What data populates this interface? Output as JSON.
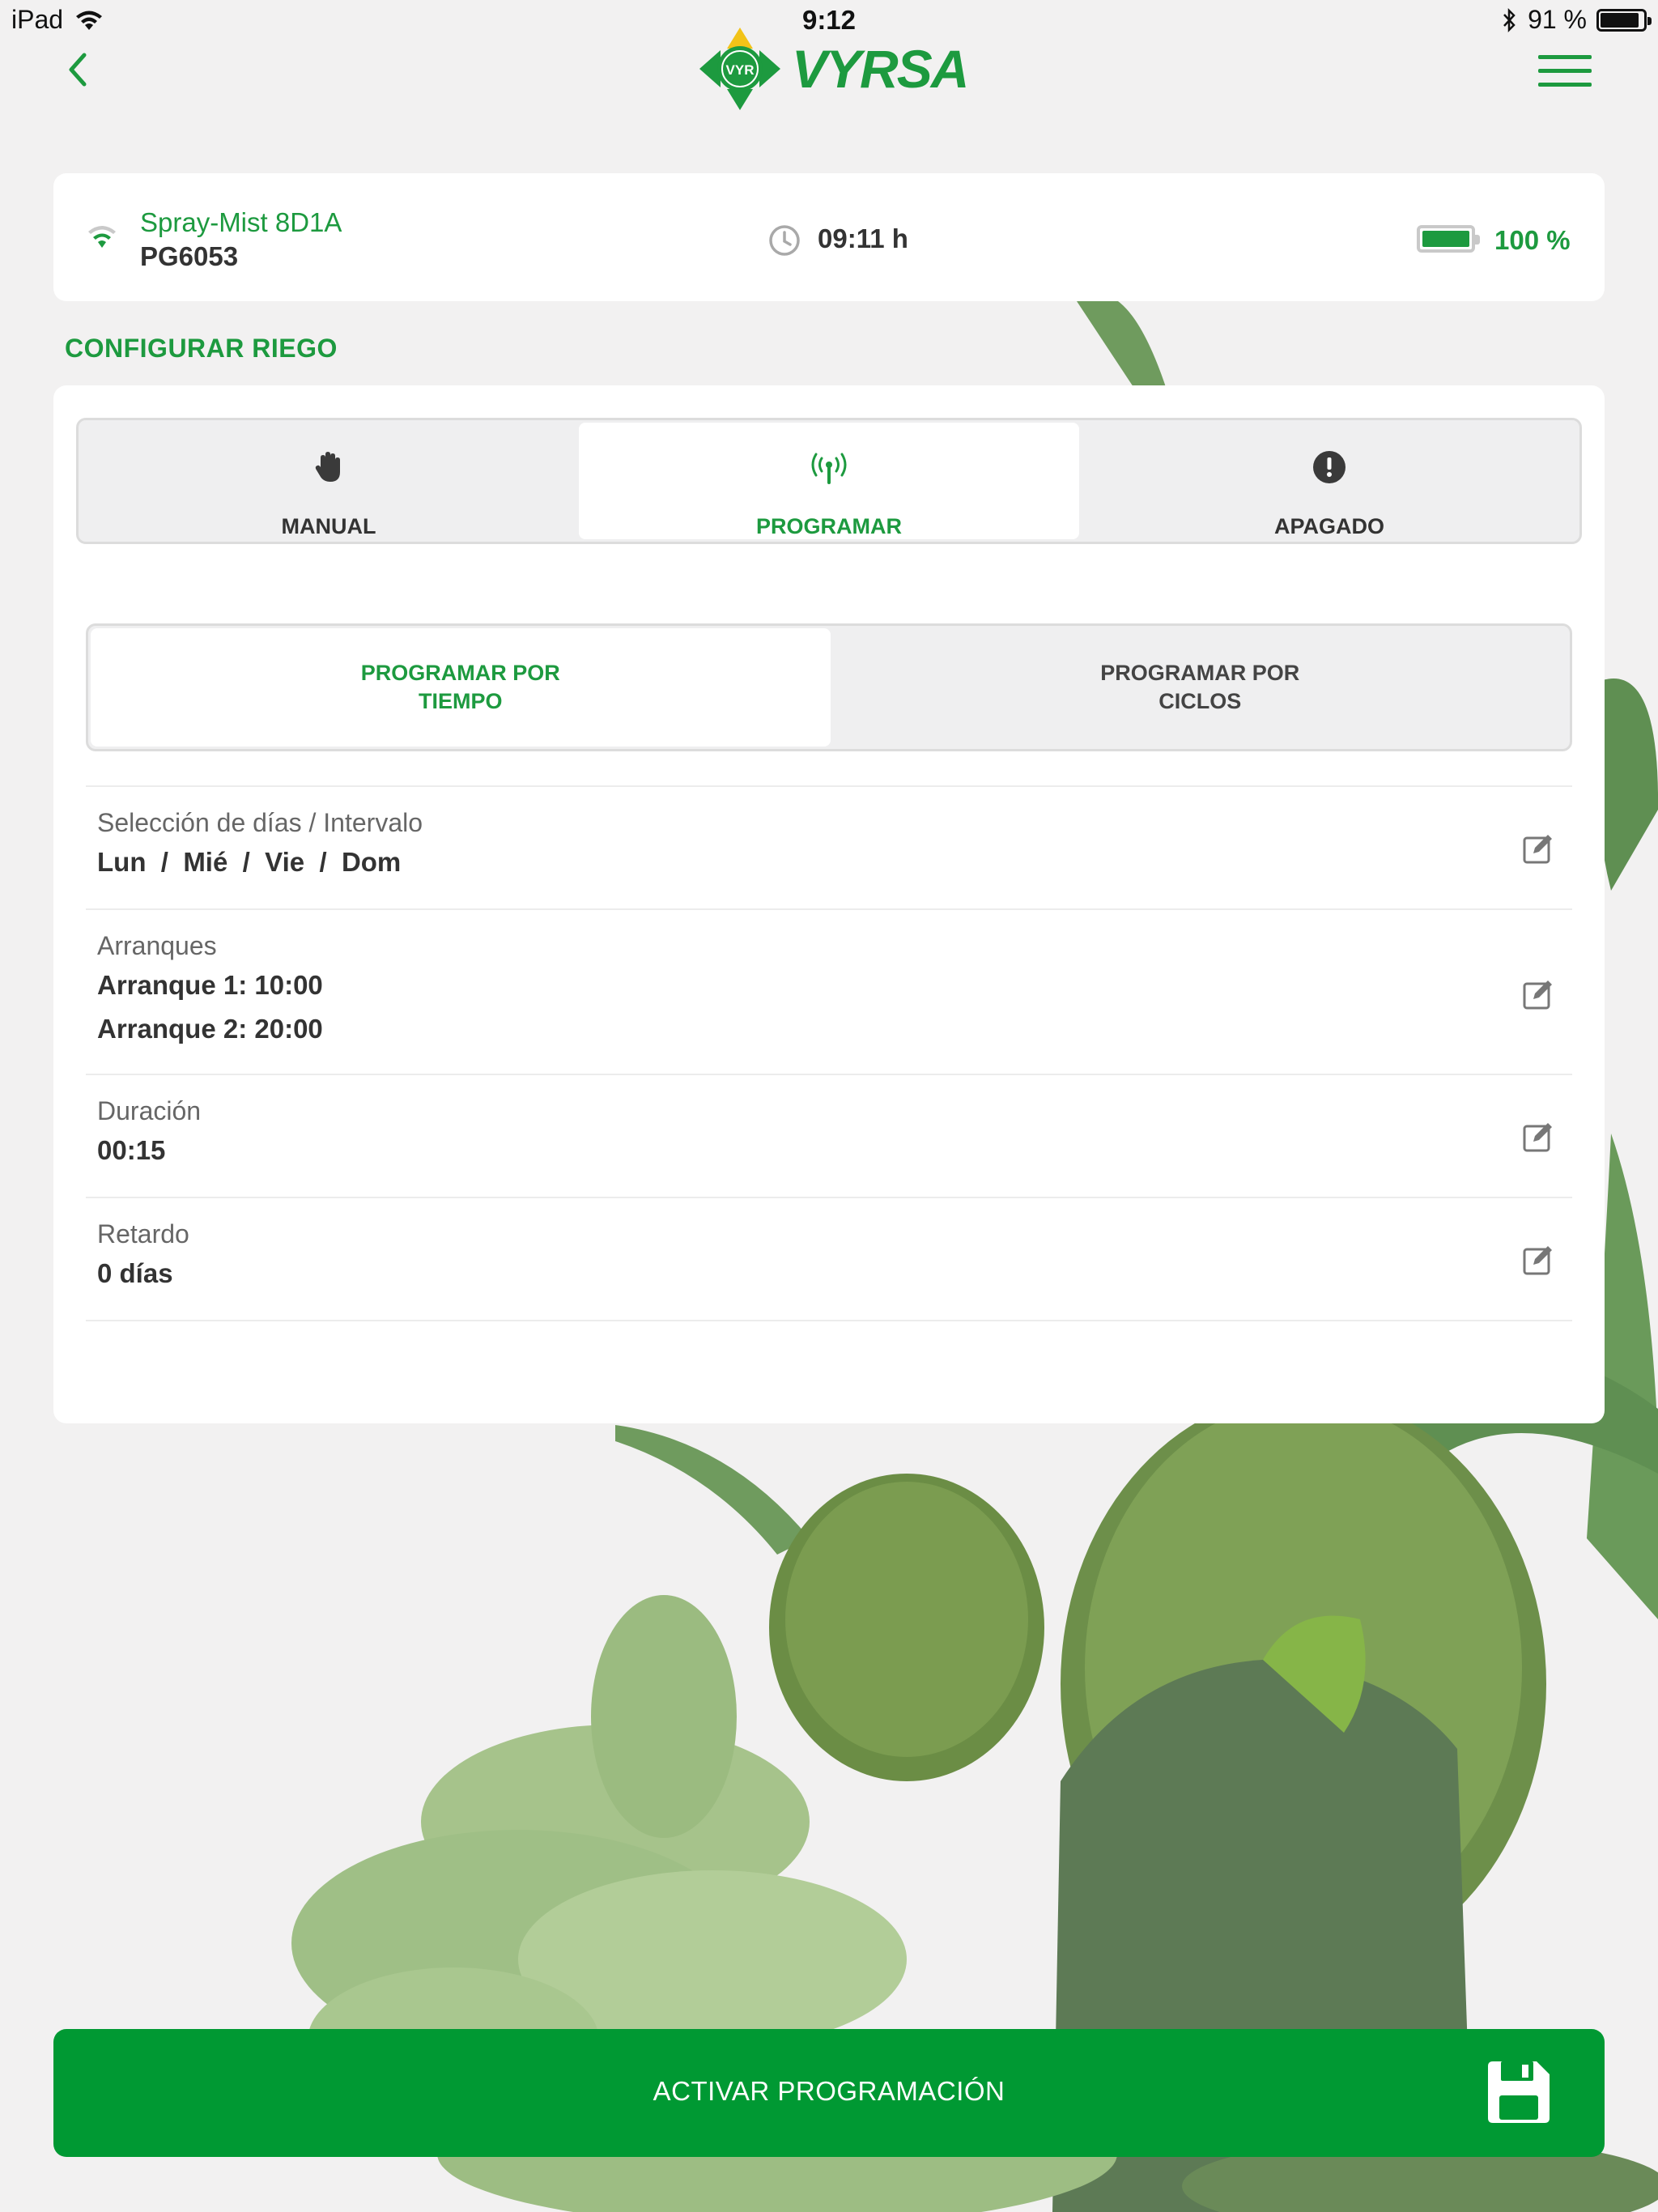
{
  "status_bar": {
    "device": "iPad",
    "time": "9:12",
    "battery": "91 %",
    "battery_level": 0.91
  },
  "nav": {
    "logo_text": "VYRSA",
    "logo_badge": "VYR"
  },
  "device": {
    "name": "Spray-Mist 8D1A",
    "model": "PG6053",
    "time": "09:11 h",
    "battery": "100 %",
    "battery_level": 1.0
  },
  "section_title": "CONFIGURAR RIEGO",
  "mode_tabs": [
    {
      "label": "MANUAL",
      "icon": "hand-icon",
      "active": false
    },
    {
      "label": "PROGRAMAR",
      "icon": "antenna-icon",
      "active": true
    },
    {
      "label": "APAGADO",
      "icon": "alert-icon",
      "active": false
    }
  ],
  "sub_tabs": [
    {
      "label": "PROGRAMAR POR TIEMPO",
      "active": true
    },
    {
      "label": "PROGRAMAR POR CICLOS",
      "active": false
    }
  ],
  "settings": {
    "days": {
      "label": "Selección de días / Intervalo",
      "value": "Lun  /  Mié  /  Vie  /  Dom"
    },
    "starts": {
      "label": "Arranques",
      "values": [
        "Arranque 1: 10:00",
        "Arranque 2: 20:00"
      ]
    },
    "duration": {
      "label": "Duración",
      "value": "00:15"
    },
    "delay": {
      "label": "Retardo",
      "value": "0 días"
    }
  },
  "action": {
    "label": "ACTIVAR PROGRAMACIÓN",
    "icon": "save-icon"
  },
  "colors": {
    "brand_green": "#1d9a3f",
    "button_green": "#009933",
    "background": "#f2f1f1"
  }
}
